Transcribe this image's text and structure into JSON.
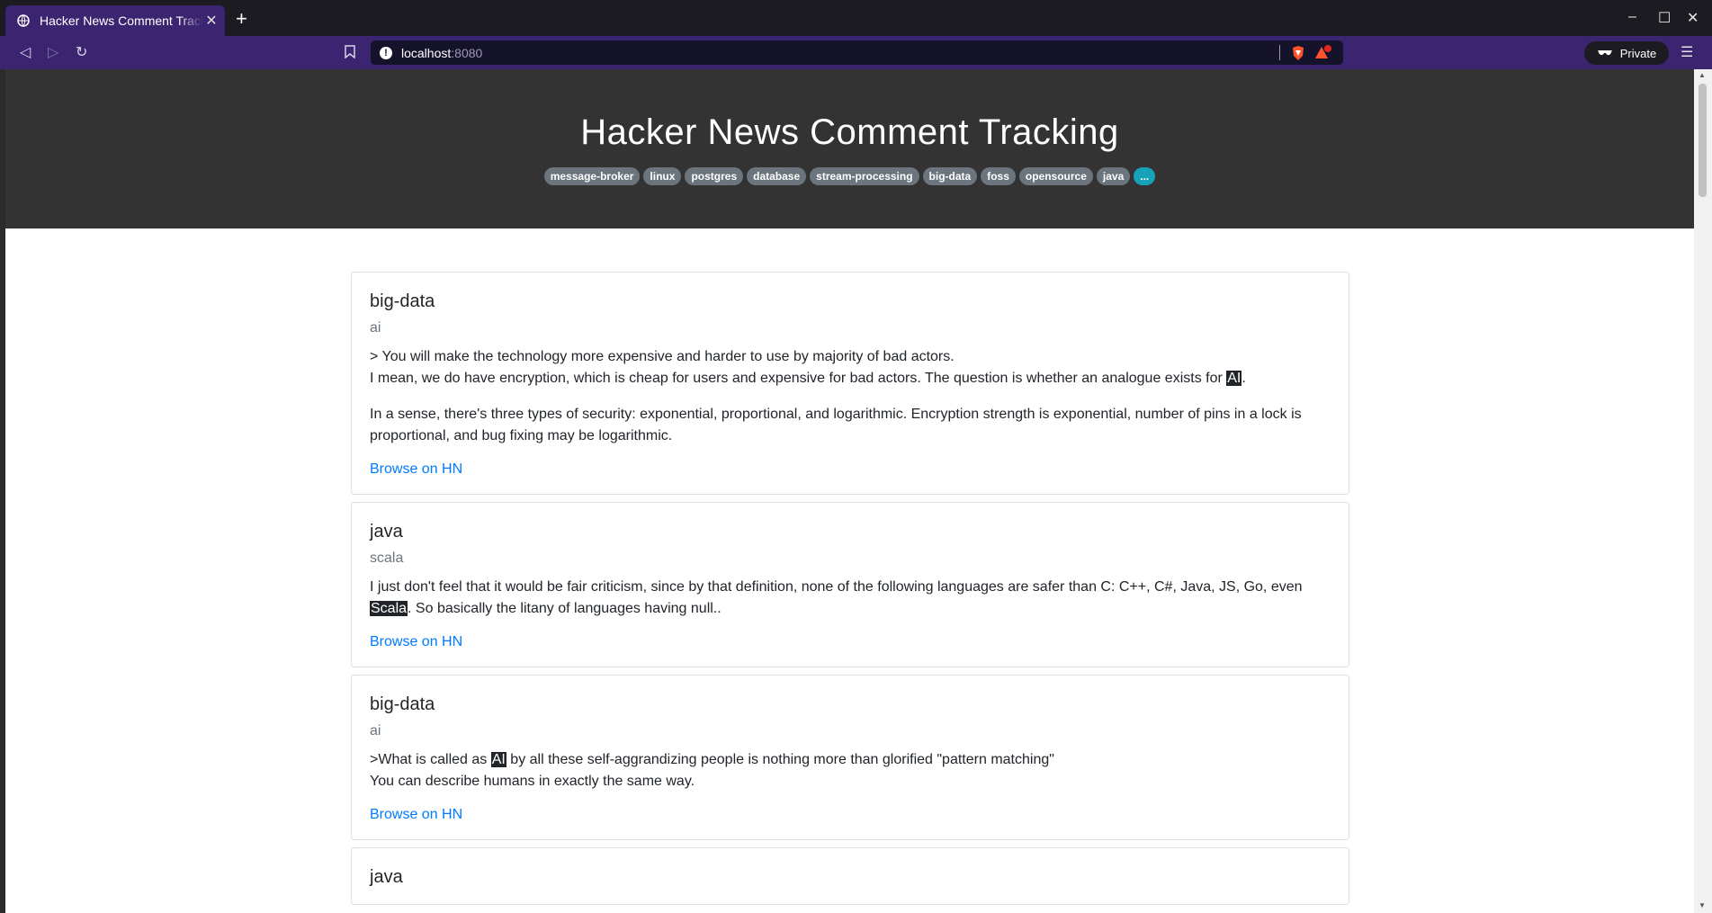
{
  "browser": {
    "tab_title": "Hacker News Comment Tracking",
    "url_host": "localhost",
    "url_port": ":8080",
    "private_label": "Private"
  },
  "page": {
    "title": "Hacker News Comment Tracking",
    "tags": [
      "message-broker",
      "linux",
      "postgres",
      "database",
      "stream-processing",
      "big-data",
      "foss",
      "opensource",
      "java"
    ],
    "more_tag": "...",
    "cards": [
      {
        "category": "big-data",
        "keyword": "ai",
        "paragraphs": [
          {
            "parts": [
              "> You will make the technology more expensive and harder to use by majority of bad actors.\nI mean, we do have encryption, which is cheap for users and expensive for bad actors. The question is whether an analogue exists for ",
              "AI",
              "."
            ]
          },
          {
            "parts": [
              "In a sense, there's three types of security: exponential, proportional, and logarithmic. Encryption strength is exponential, number of pins in a lock is proportional, and bug fixing may be logarithmic."
            ]
          }
        ],
        "link": "Browse on HN"
      },
      {
        "category": "java",
        "keyword": "scala",
        "paragraphs": [
          {
            "parts": [
              "I just don't feel that it would be fair criticism, since by that definition, none of the following languages are safer than C: C++, C#, Java, JS, Go, even ",
              "Scala",
              ". So basically the litany of languages having null.."
            ]
          }
        ],
        "link": "Browse on HN"
      },
      {
        "category": "big-data",
        "keyword": "ai",
        "paragraphs": [
          {
            "parts": [
              ">What is called as ",
              "AI",
              " by all these self-aggrandizing people is nothing more than glorified \"pattern matching\"\nYou can describe humans in exactly the same way."
            ]
          }
        ],
        "link": "Browse on HN"
      },
      {
        "category": "java",
        "keyword": "",
        "paragraphs": [],
        "link": ""
      }
    ]
  }
}
